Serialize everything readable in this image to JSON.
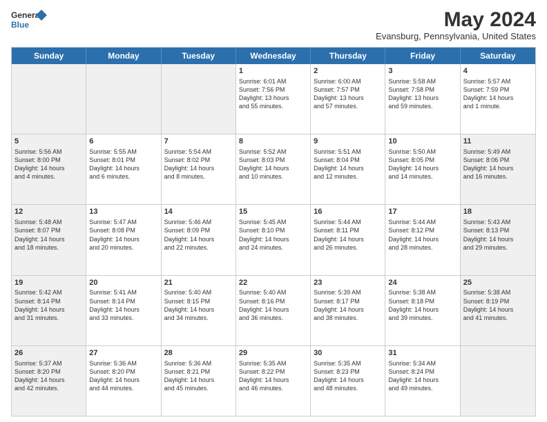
{
  "logo": {
    "line1": "General",
    "line2": "Blue"
  },
  "title": "May 2024",
  "location": "Evansburg, Pennsylvania, United States",
  "days_of_week": [
    "Sunday",
    "Monday",
    "Tuesday",
    "Wednesday",
    "Thursday",
    "Friday",
    "Saturday"
  ],
  "weeks": [
    [
      {
        "day": "",
        "info": "",
        "shaded": true
      },
      {
        "day": "",
        "info": "",
        "shaded": true
      },
      {
        "day": "",
        "info": "",
        "shaded": true
      },
      {
        "day": "1",
        "info": "Sunrise: 6:01 AM\nSunset: 7:56 PM\nDaylight: 13 hours\nand 55 minutes.",
        "shaded": false
      },
      {
        "day": "2",
        "info": "Sunrise: 6:00 AM\nSunset: 7:57 PM\nDaylight: 13 hours\nand 57 minutes.",
        "shaded": false
      },
      {
        "day": "3",
        "info": "Sunrise: 5:58 AM\nSunset: 7:58 PM\nDaylight: 13 hours\nand 59 minutes.",
        "shaded": false
      },
      {
        "day": "4",
        "info": "Sunrise: 5:57 AM\nSunset: 7:59 PM\nDaylight: 14 hours\nand 1 minute.",
        "shaded": false
      }
    ],
    [
      {
        "day": "5",
        "info": "Sunrise: 5:56 AM\nSunset: 8:00 PM\nDaylight: 14 hours\nand 4 minutes.",
        "shaded": true
      },
      {
        "day": "6",
        "info": "Sunrise: 5:55 AM\nSunset: 8:01 PM\nDaylight: 14 hours\nand 6 minutes.",
        "shaded": false
      },
      {
        "day": "7",
        "info": "Sunrise: 5:54 AM\nSunset: 8:02 PM\nDaylight: 14 hours\nand 8 minutes.",
        "shaded": false
      },
      {
        "day": "8",
        "info": "Sunrise: 5:52 AM\nSunset: 8:03 PM\nDaylight: 14 hours\nand 10 minutes.",
        "shaded": false
      },
      {
        "day": "9",
        "info": "Sunrise: 5:51 AM\nSunset: 8:04 PM\nDaylight: 14 hours\nand 12 minutes.",
        "shaded": false
      },
      {
        "day": "10",
        "info": "Sunrise: 5:50 AM\nSunset: 8:05 PM\nDaylight: 14 hours\nand 14 minutes.",
        "shaded": false
      },
      {
        "day": "11",
        "info": "Sunrise: 5:49 AM\nSunset: 8:06 PM\nDaylight: 14 hours\nand 16 minutes.",
        "shaded": true
      }
    ],
    [
      {
        "day": "12",
        "info": "Sunrise: 5:48 AM\nSunset: 8:07 PM\nDaylight: 14 hours\nand 18 minutes.",
        "shaded": true
      },
      {
        "day": "13",
        "info": "Sunrise: 5:47 AM\nSunset: 8:08 PM\nDaylight: 14 hours\nand 20 minutes.",
        "shaded": false
      },
      {
        "day": "14",
        "info": "Sunrise: 5:46 AM\nSunset: 8:09 PM\nDaylight: 14 hours\nand 22 minutes.",
        "shaded": false
      },
      {
        "day": "15",
        "info": "Sunrise: 5:45 AM\nSunset: 8:10 PM\nDaylight: 14 hours\nand 24 minutes.",
        "shaded": false
      },
      {
        "day": "16",
        "info": "Sunrise: 5:44 AM\nSunset: 8:11 PM\nDaylight: 14 hours\nand 26 minutes.",
        "shaded": false
      },
      {
        "day": "17",
        "info": "Sunrise: 5:44 AM\nSunset: 8:12 PM\nDaylight: 14 hours\nand 28 minutes.",
        "shaded": false
      },
      {
        "day": "18",
        "info": "Sunrise: 5:43 AM\nSunset: 8:13 PM\nDaylight: 14 hours\nand 29 minutes.",
        "shaded": true
      }
    ],
    [
      {
        "day": "19",
        "info": "Sunrise: 5:42 AM\nSunset: 8:14 PM\nDaylight: 14 hours\nand 31 minutes.",
        "shaded": true
      },
      {
        "day": "20",
        "info": "Sunrise: 5:41 AM\nSunset: 8:14 PM\nDaylight: 14 hours\nand 33 minutes.",
        "shaded": false
      },
      {
        "day": "21",
        "info": "Sunrise: 5:40 AM\nSunset: 8:15 PM\nDaylight: 14 hours\nand 34 minutes.",
        "shaded": false
      },
      {
        "day": "22",
        "info": "Sunrise: 5:40 AM\nSunset: 8:16 PM\nDaylight: 14 hours\nand 36 minutes.",
        "shaded": false
      },
      {
        "day": "23",
        "info": "Sunrise: 5:39 AM\nSunset: 8:17 PM\nDaylight: 14 hours\nand 38 minutes.",
        "shaded": false
      },
      {
        "day": "24",
        "info": "Sunrise: 5:38 AM\nSunset: 8:18 PM\nDaylight: 14 hours\nand 39 minutes.",
        "shaded": false
      },
      {
        "day": "25",
        "info": "Sunrise: 5:38 AM\nSunset: 8:19 PM\nDaylight: 14 hours\nand 41 minutes.",
        "shaded": true
      }
    ],
    [
      {
        "day": "26",
        "info": "Sunrise: 5:37 AM\nSunset: 8:20 PM\nDaylight: 14 hours\nand 42 minutes.",
        "shaded": true
      },
      {
        "day": "27",
        "info": "Sunrise: 5:36 AM\nSunset: 8:20 PM\nDaylight: 14 hours\nand 44 minutes.",
        "shaded": false
      },
      {
        "day": "28",
        "info": "Sunrise: 5:36 AM\nSunset: 8:21 PM\nDaylight: 14 hours\nand 45 minutes.",
        "shaded": false
      },
      {
        "day": "29",
        "info": "Sunrise: 5:35 AM\nSunset: 8:22 PM\nDaylight: 14 hours\nand 46 minutes.",
        "shaded": false
      },
      {
        "day": "30",
        "info": "Sunrise: 5:35 AM\nSunset: 8:23 PM\nDaylight: 14 hours\nand 48 minutes.",
        "shaded": false
      },
      {
        "day": "31",
        "info": "Sunrise: 5:34 AM\nSunset: 8:24 PM\nDaylight: 14 hours\nand 49 minutes.",
        "shaded": false
      },
      {
        "day": "",
        "info": "",
        "shaded": true
      }
    ]
  ],
  "colors": {
    "header_bg": "#2c6fad",
    "shaded_cell": "#f0f0f0",
    "border": "#cccccc"
  }
}
